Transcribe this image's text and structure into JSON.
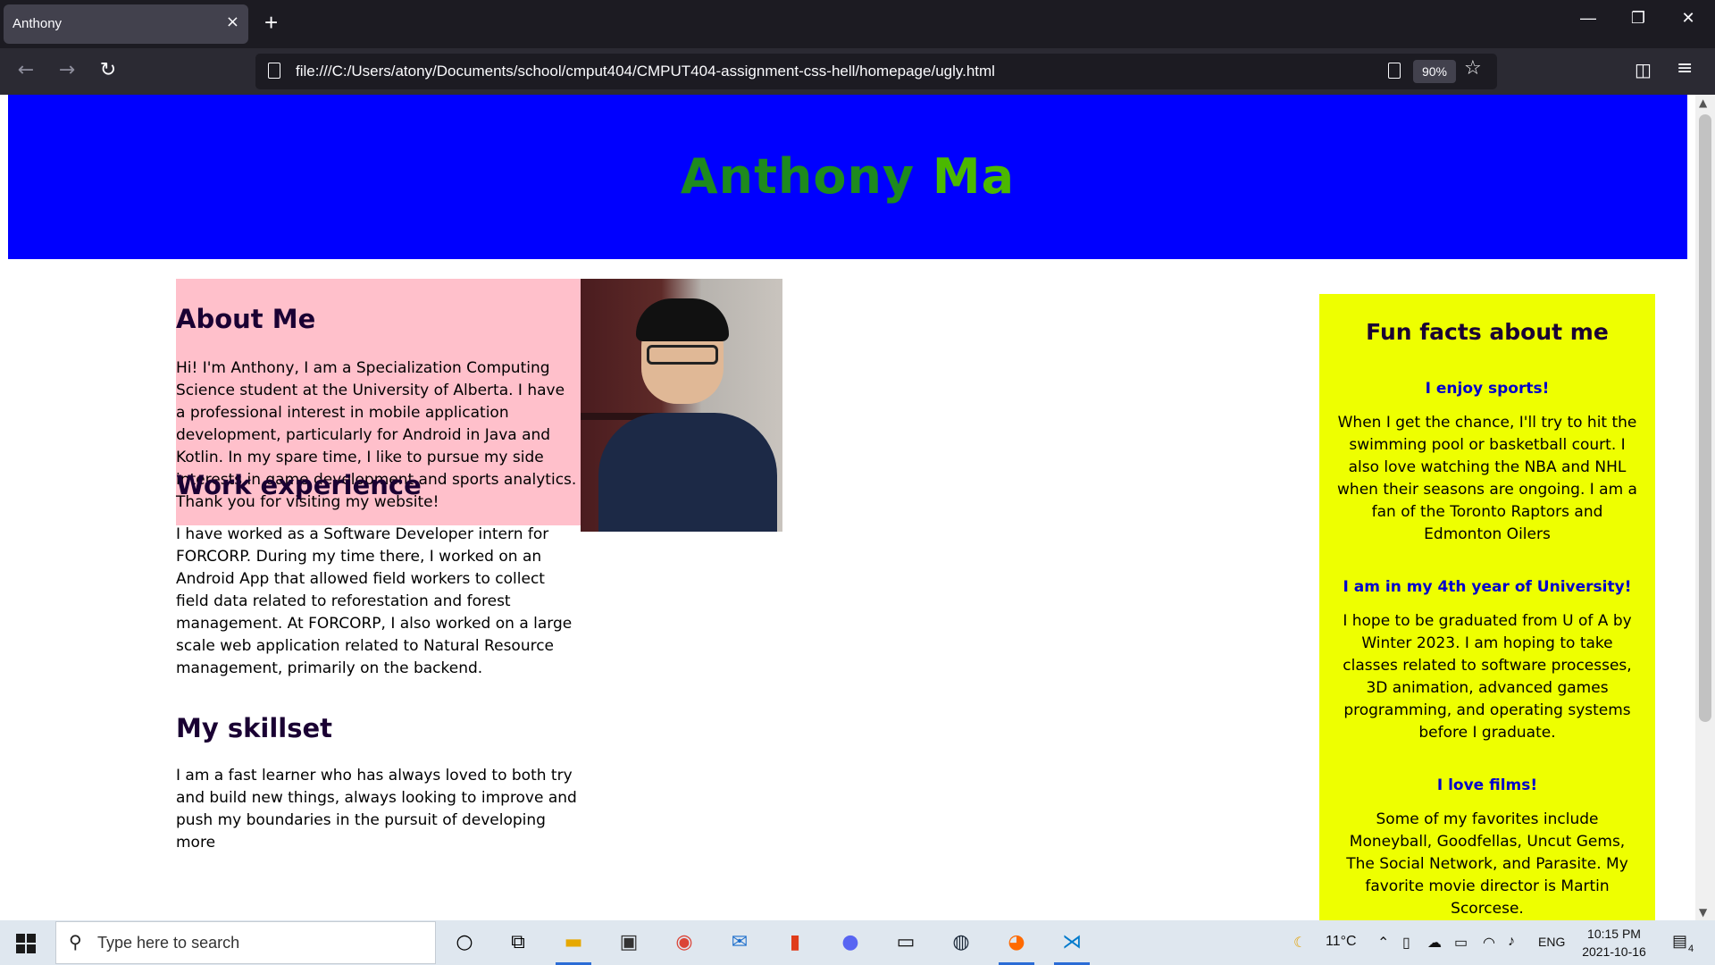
{
  "browser": {
    "tab_title": "Anthony",
    "close_glyph": "×",
    "new_tab_glyph": "+",
    "url": "file:///C:/Users/atony/Documents/school/cmput404/CMPUT404-assignment-css-hell/homepage/ugly.html",
    "zoom": "90%"
  },
  "page": {
    "name_first": "Anthony",
    "name_last": "Ma",
    "about": {
      "heading": "About Me",
      "text": "Hi! I'm Anthony, I am a Specialization Computing Science student at the University of Alberta. I have a professional interest in mobile application development, particularly for Android in Java and Kotlin. In my spare time, I like to pursue my side interests in game development and sports analytics. Thank you for visiting my website!"
    },
    "work": {
      "heading": "Work experience",
      "text": "I have worked as a Software Developer intern for FORCORP. During my time there, I worked on an Android App that allowed field workers to collect field data related to reforestation and forest management. At FORCORP, I also worked on a large scale web application related to Natural Resource management, primarily on the backend."
    },
    "skills": {
      "heading": "My skillset",
      "text": "I am a fast learner who has always loved to both try and build new things, always looking to improve and push my boundaries in the pursuit of developing more"
    },
    "facts": {
      "title": "Fun facts about me",
      "items": [
        {
          "heading": "I enjoy sports!",
          "text": "When I get the chance, I'll try to hit the swimming pool or basketball court. I also love watching the NBA and NHL when their seasons are ongoing. I am a fan of the Toronto Raptors and Edmonton Oilers"
        },
        {
          "heading": "I am in my 4th year of University!",
          "text": "I hope to be graduated from U of A by Winter 2023. I am hoping to take classes related to software processes, 3D animation, advanced games programming, and operating systems before I graduate."
        },
        {
          "heading": "I love films!",
          "text": "Some of my favorites include Moneyball, Goodfellas, Uncut Gems, The Social Network, and Parasite. My favorite movie director is Martin Scorcese."
        }
      ]
    }
  },
  "taskbar": {
    "search_placeholder": "Type here to search",
    "weather": "11°C",
    "language": "ENG",
    "time": "10:15 PM",
    "date": "2021-10-16",
    "notifications": "4",
    "apps": [
      "cortana-icon",
      "task-view-icon",
      "file-explorer-icon",
      "store-icon",
      "chrome-icon",
      "mail-icon",
      "office-icon",
      "discord-icon",
      "terminal-icon",
      "steam-icon",
      "firefox-icon",
      "vscode-icon"
    ]
  },
  "colors": {
    "banner": "#0000ff",
    "about_bg": "#ffc0cb",
    "facts_bg": "#eeff00",
    "name": "#4bb800",
    "fact_heading": "#0000cc"
  }
}
